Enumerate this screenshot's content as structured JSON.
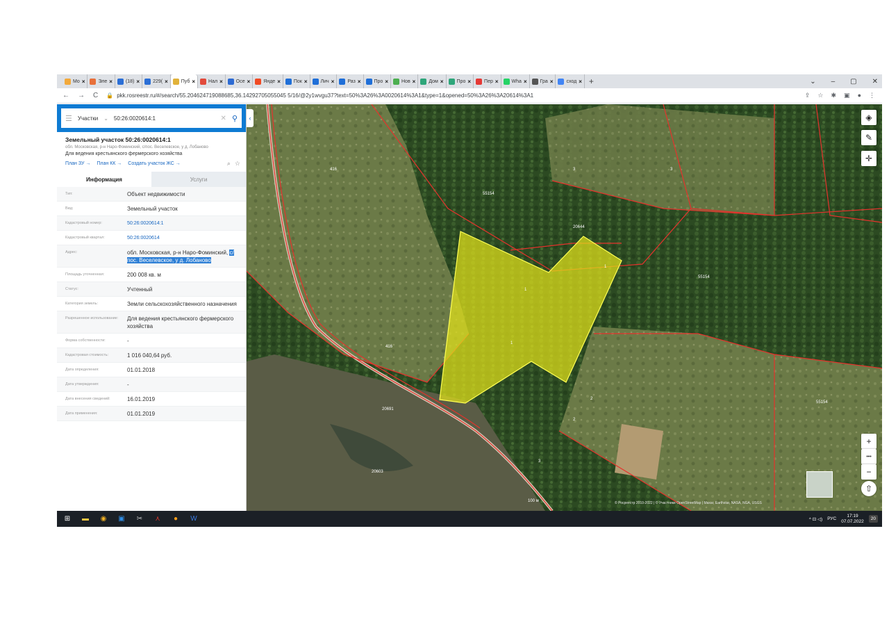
{
  "browser": {
    "tabs": [
      {
        "label": "Мо",
        "color": "#f2a93b"
      },
      {
        "label": "Эле",
        "color": "#e8703a"
      },
      {
        "label": "(18)",
        "color": "#2b6fd6"
      },
      {
        "label": "229(",
        "color": "#2b6fd6"
      },
      {
        "label": "Пуб",
        "color": "#e1b23a",
        "active": true
      },
      {
        "label": "Нал",
        "color": "#e24a3b"
      },
      {
        "label": "Осе",
        "color": "#2d6bd3"
      },
      {
        "label": "Янде",
        "color": "#f04a24"
      },
      {
        "label": "Пок",
        "color": "#1f6fd8"
      },
      {
        "label": "Лич",
        "color": "#1f6fd8"
      },
      {
        "label": "Раз",
        "color": "#1f6fd8"
      },
      {
        "label": "Про",
        "color": "#1f6fd8"
      },
      {
        "label": "Нов",
        "color": "#4caf50"
      },
      {
        "label": "Дом",
        "color": "#2ea67a"
      },
      {
        "label": "Про",
        "color": "#2ea67a"
      },
      {
        "label": "Пер",
        "color": "#e53935"
      },
      {
        "label": "Wha",
        "color": "#25d366"
      },
      {
        "label": "Гра",
        "color": "#555555"
      },
      {
        "label": "сход",
        "color": "#4285f4"
      }
    ],
    "tab_close": "×",
    "new_tab": "+",
    "window_controls": [
      "⌄",
      "–",
      "▢",
      "✕"
    ],
    "url": "pkk.rosreestr.ru/#/search/55.204624719088685,36.14292705055045 5/16/@2y1wvgu37?text=50%3A26%3A0020614%3A1&type=1&opened=50%3A26%3A20614%3A1",
    "nav": {
      "back": "←",
      "forward": "→",
      "reload": "C"
    }
  },
  "panel": {
    "search_mode": "Участки",
    "search_value": "50:26:0020614:1",
    "title": "Земельный участок 50:26:0020614:1",
    "address_line": "обл. Московская, р-н Наро-Фоминский, с/пос. Веселевское, у д. Лобаново",
    "use_line": "Для ведения крестьянского фермерского хозяйства",
    "links": [
      "План ЗУ →",
      "План КК →",
      "Создать участок ЖС →"
    ],
    "tab_info": "Информация",
    "tab_services": "Услуги",
    "rows": [
      {
        "key": "Тип:",
        "value": "Объект недвижимости"
      },
      {
        "key": "Вид:",
        "value": "Земельный участок"
      },
      {
        "key": "Кадастровый номер:",
        "value": "50:26:0020614:1",
        "link": true
      },
      {
        "key": "Кадастровый квартал:",
        "value": "50:26:0020614",
        "link": true
      },
      {
        "key": "Адрес:",
        "value": "обл. Московская, р-н Наро-Фоминский, ",
        "selected": "с/пос. Веселевское, у д. Лобаново"
      },
      {
        "key": "Площадь уточненная:",
        "value": "200 008 кв. м"
      },
      {
        "key": "Статус:",
        "value": "Учтенный"
      },
      {
        "key": "Категория земель:",
        "value": "Земли сельскохозяйственного назначения"
      },
      {
        "key": "Разрешенное использование:",
        "value": "Для ведения крестьянского фермерского хозяйства"
      },
      {
        "key": "Форма собственности:",
        "value": "-"
      },
      {
        "key": "Кадастровая стоимость:",
        "value": "1 016 040,64 руб."
      },
      {
        "key": "Дата определения:",
        "value": "01.01.2018"
      },
      {
        "key": "Дата утверждения:",
        "value": "-"
      },
      {
        "key": "Дата внесения сведений:",
        "value": "16.01.2019"
      },
      {
        "key": "Дата применения:",
        "value": "01.01.2019"
      }
    ]
  },
  "map": {
    "labels": [
      "55154",
      "20644",
      "55154",
      "55154",
      "416",
      "416",
      "3",
      "3",
      "1",
      "1",
      "1",
      "2",
      "2",
      "3",
      "20691",
      "20603"
    ],
    "zoom_in": "+",
    "zoom_dots": "•••",
    "zoom_out": "−",
    "scale": "100 м",
    "attribution": "© Росреестр 2010-2022 | © Участники OpenStreetMap | Maxar, Earthstar, NASA, NGA, USGS",
    "colors": {
      "forest": "#2c4a22",
      "field": "#6d7a48",
      "parcel_fill": "#e2e21a",
      "boundary": "#e5322c"
    }
  },
  "taskbar": {
    "lang": "РУС",
    "time": "17:19",
    "date": "07.07.2022",
    "notif": "20",
    "tray": "^ ⊡ ◁)"
  }
}
